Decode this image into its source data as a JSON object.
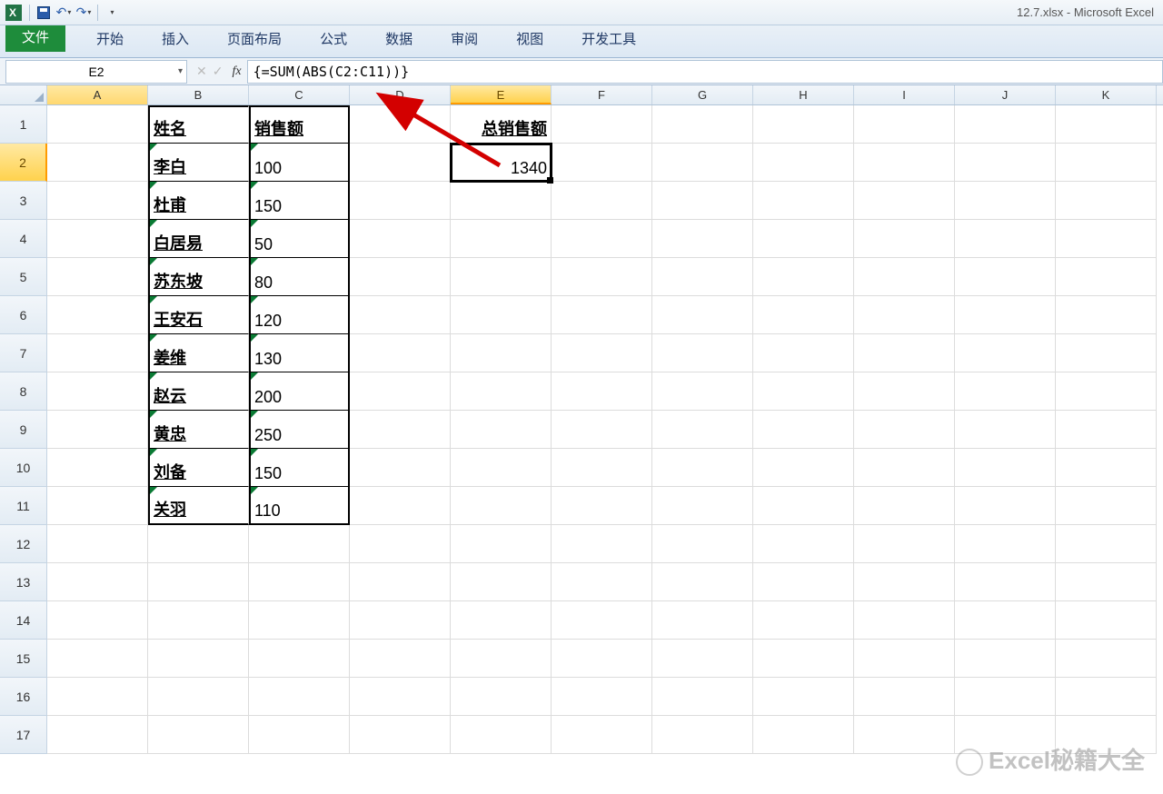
{
  "window": {
    "title": "12.7.xlsx - Microsoft Excel"
  },
  "ribbon": {
    "file": "文件",
    "tabs": [
      "开始",
      "插入",
      "页面布局",
      "公式",
      "数据",
      "审阅",
      "视图",
      "开发工具"
    ]
  },
  "formulaBar": {
    "nameBox": "E2",
    "formula": "{=SUM(ABS(C2:C11))}"
  },
  "columns": [
    "A",
    "B",
    "C",
    "D",
    "E",
    "F",
    "G",
    "H",
    "I",
    "J",
    "K"
  ],
  "rowNumbers": [
    1,
    2,
    3,
    4,
    5,
    6,
    7,
    8,
    9,
    10,
    11,
    12,
    13,
    14,
    15,
    16,
    17
  ],
  "header": {
    "name": "姓名",
    "sales": "销售额",
    "total": "总销售额"
  },
  "data": [
    {
      "name": "李白",
      "sales": "100"
    },
    {
      "name": "杜甫",
      "sales": "150"
    },
    {
      "name": "白居易",
      "sales": "50"
    },
    {
      "name": "苏东坡",
      "sales": "80"
    },
    {
      "name": "王安石",
      "sales": "120"
    },
    {
      "name": "姜维",
      "sales": "130"
    },
    {
      "name": "赵云",
      "sales": "200"
    },
    {
      "name": "黄忠",
      "sales": "250"
    },
    {
      "name": "刘备",
      "sales": "150"
    },
    {
      "name": "关羽",
      "sales": "110"
    }
  ],
  "totalValue": "1340",
  "selectedCell": "E2",
  "watermark": "Excel秘籍大全"
}
